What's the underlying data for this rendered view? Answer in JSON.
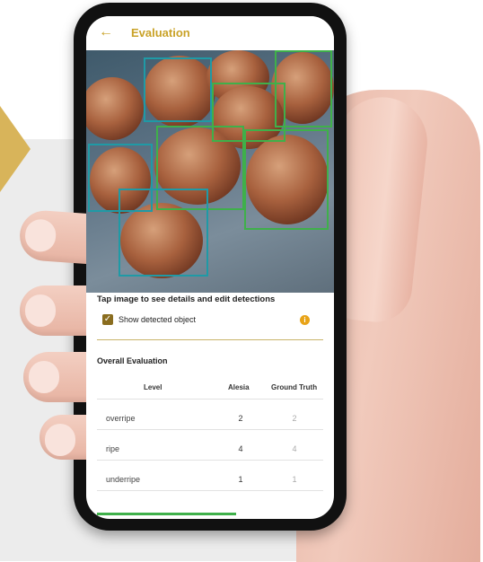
{
  "header": {
    "title": "Evaluation",
    "back_icon": "arrow-left-icon"
  },
  "image": {
    "description_hidden": true
  },
  "hint_text": "Tap image to see details and edit detections",
  "show_detected": {
    "label": "Show detected object",
    "checked": true,
    "info_icon": "info-icon"
  },
  "evaluation": {
    "title": "Overall Evaluation",
    "columns": [
      "Level",
      "Alesia",
      "Ground Truth"
    ],
    "rows": [
      {
        "level": "overripe",
        "alesia": "2",
        "ground_truth": "2"
      },
      {
        "level": "ripe",
        "alesia": "4",
        "ground_truth": "4"
      },
      {
        "level": "underripe",
        "alesia": "1",
        "ground_truth": "1"
      }
    ]
  },
  "colors": {
    "accent": "#c9a227",
    "box_teal": "#1f9aa6",
    "box_green": "#3fb04a"
  }
}
